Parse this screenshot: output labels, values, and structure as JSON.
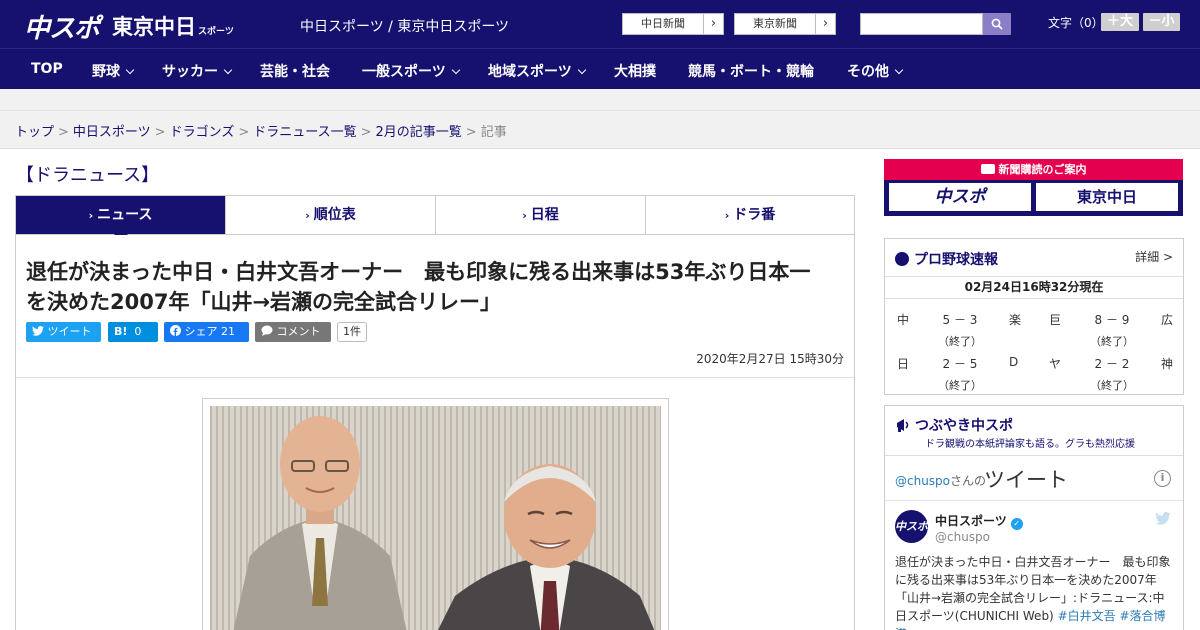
{
  "header": {
    "logo_chuspo": "中スポ",
    "logo_tokyo": "東京中日",
    "logo_tokyo_small": "スポーツ",
    "site_title": "中日スポーツ / 東京中日スポーツ",
    "btn_chunichi": "中日新聞",
    "btn_tokyo": "東京新聞",
    "search_placeholder": "",
    "font_label": "文字（0）",
    "font_bigger": "＋大",
    "font_smaller": "－小",
    "colors": {
      "primary": "#16106f",
      "accent": "#e5004f"
    }
  },
  "nav": {
    "items": [
      {
        "label": "TOP",
        "has_dropdown": false
      },
      {
        "label": "野球",
        "has_dropdown": true
      },
      {
        "label": "サッカー",
        "has_dropdown": true
      },
      {
        "label": "芸能・社会",
        "has_dropdown": false
      },
      {
        "label": "一般スポーツ",
        "has_dropdown": true
      },
      {
        "label": "地域スポーツ",
        "has_dropdown": true
      },
      {
        "label": "大相撲",
        "has_dropdown": false
      },
      {
        "label": "競馬・ボート・競輪",
        "has_dropdown": false
      },
      {
        "label": "その他",
        "has_dropdown": true
      }
    ]
  },
  "breadcrumb": {
    "items": [
      "トップ",
      "中日スポーツ",
      "ドラゴンズ",
      "ドラニュース一覧",
      "2月の記事一覧"
    ],
    "separator": ">",
    "current": "記事"
  },
  "section": {
    "heading": "【ドラニュース】"
  },
  "tabs": [
    {
      "label": "ニュース",
      "active": true
    },
    {
      "label": "順位表",
      "active": false
    },
    {
      "label": "日程",
      "active": false
    },
    {
      "label": "ドラ番",
      "active": false
    }
  ],
  "tab_marker": "›",
  "article": {
    "title_line1": "退任が決まった中日・白井文吾オーナー　最も印象に残る出来事は53年ぶり日本一",
    "title_line2": "を決めた2007年「山井→岩瀬の完全試合リレー」",
    "share": {
      "tweet": "ツイート",
      "hatena_icon": "B!",
      "hatena_count": "0",
      "facebook": "シェア",
      "facebook_count": "21",
      "comment": "コメント",
      "comment_count": "1件"
    },
    "date": "2020年2月27日 15時30分"
  },
  "sidebar": {
    "subscription": {
      "header": "新聞購読のご案内",
      "logo_chuspo": "中スポ",
      "logo_tokyo": "東京中日"
    },
    "baseball": {
      "title": "プロ野球速報",
      "detail": "詳細 >",
      "timestamp": "02月24日16時32分現在",
      "games": [
        {
          "home": "中",
          "score": "5 － 3",
          "away": "楽",
          "status": "（終了）"
        },
        {
          "home": "巨",
          "score": "8 － 9",
          "away": "広",
          "status": "（終了）"
        },
        {
          "home": "日",
          "score": "2 － 5",
          "away": "D",
          "status": "（終了）"
        },
        {
          "home": "ヤ",
          "score": "2 － 2",
          "away": "神",
          "status": "（終了）"
        }
      ]
    },
    "twitter": {
      "title": "つぶやき中スポ",
      "subtitle": "ドラ観戦の本紙評論家も語る。グラも熱烈応援",
      "user_link": "@chuspo",
      "user_suffix": "さんの",
      "header_label": "ツイート",
      "info_icon": "i",
      "avatar_text": "中スポ",
      "name": "中日スポーツ",
      "verified_icon": "✓",
      "handle": "@chuspo",
      "text": "退任が決まった中日・白井文吾オーナー　最も印象に残る出来事は53年ぶり日本一を決めた2007年「山井→岩瀬の完全試合リレー」:ドラニュース:中日スポーツ(CHUNICHI Web) ",
      "tags": [
        "#白井文吾",
        "#落合博満"
      ]
    }
  }
}
